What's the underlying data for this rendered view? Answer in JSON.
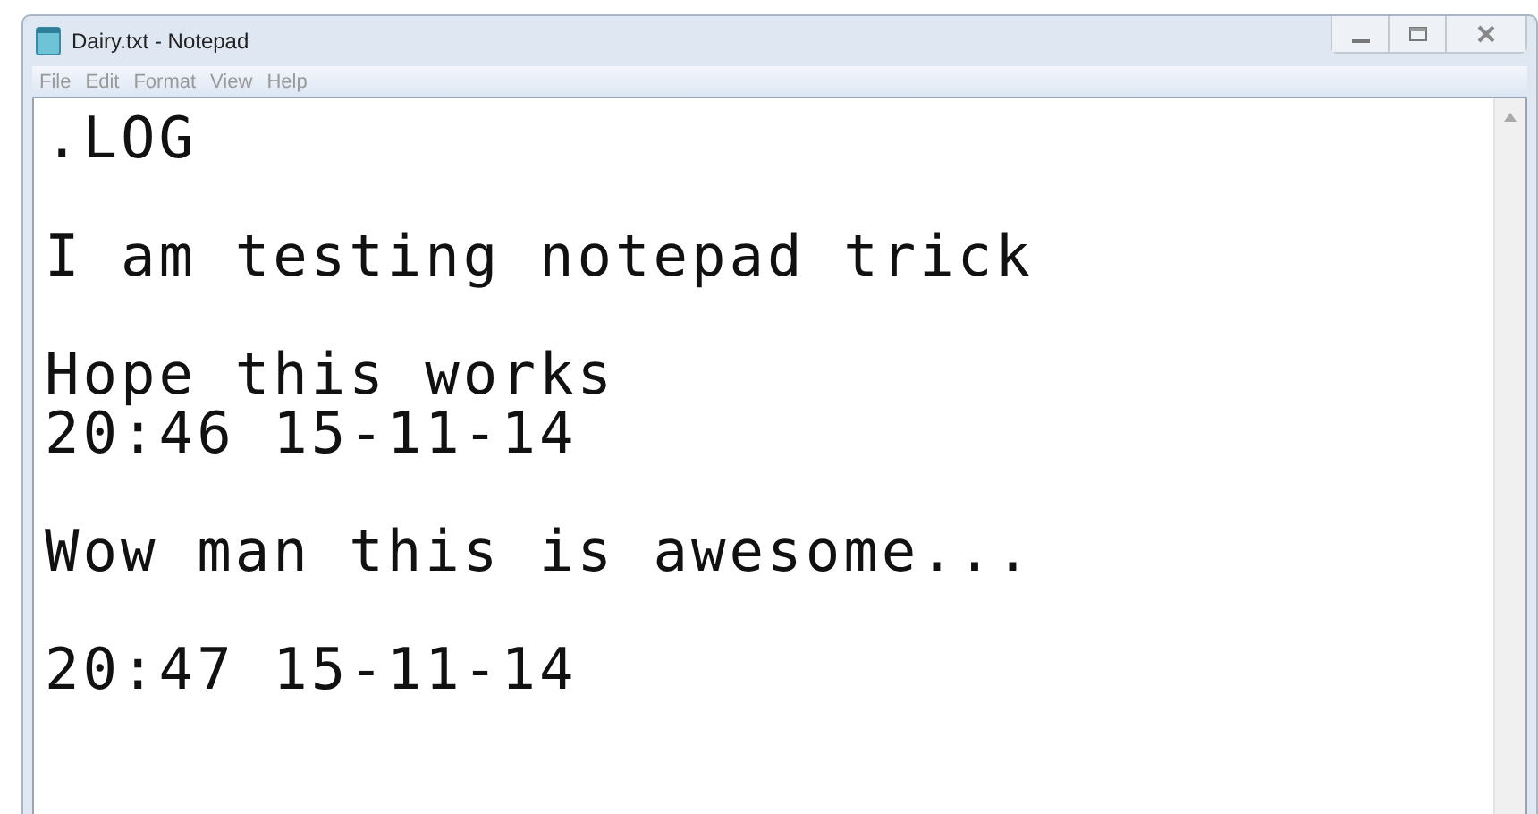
{
  "window": {
    "title": "Dairy.txt - Notepad"
  },
  "menu": [
    "File",
    "Edit",
    "Format",
    "View",
    "Help"
  ],
  "document": {
    "paragraphs": [
      [
        ".LOG"
      ],
      [
        "I am testing notepad trick"
      ],
      [
        "Hope this works",
        "20:46 15-11-14"
      ],
      [
        "Wow man this is awesome..."
      ],
      [
        "20:47 15-11-14"
      ]
    ]
  }
}
